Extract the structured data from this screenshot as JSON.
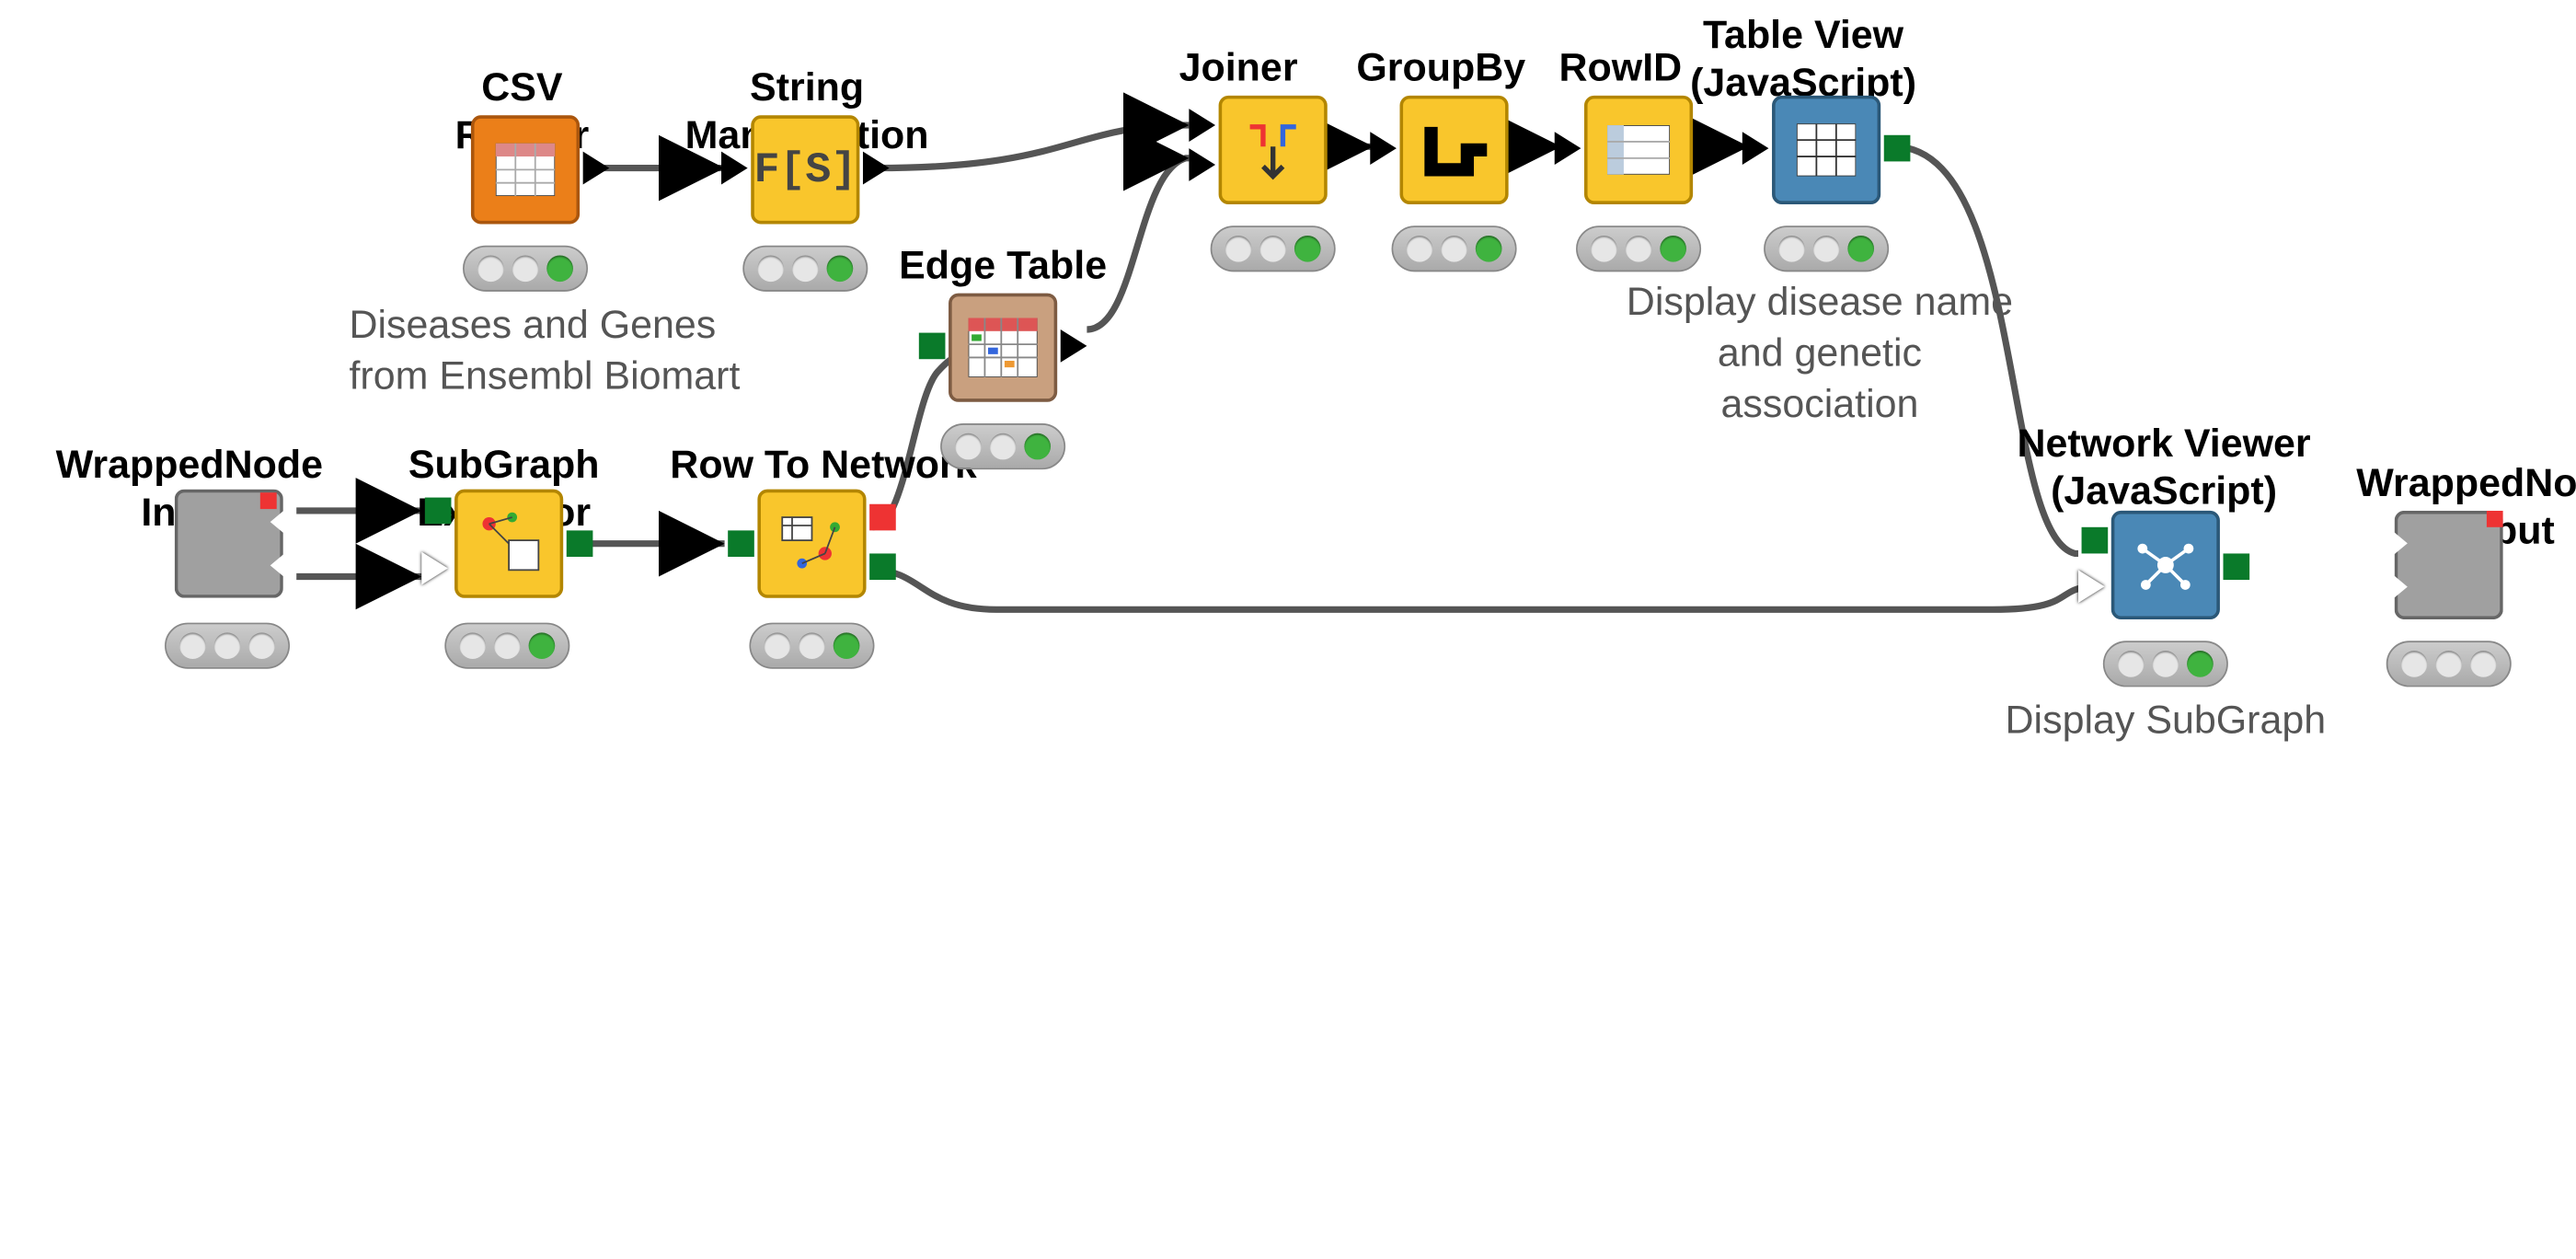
{
  "nodes": {
    "wrapped_input": {
      "title": "WrappedNode Input"
    },
    "subgraph_extractor": {
      "title": "SubGraph Extractor"
    },
    "row_to_network": {
      "title": "Row To Network"
    },
    "csv_reader": {
      "title": "CSV Reader",
      "desc": "Diseases and Genes\nfrom Ensembl Biomart"
    },
    "string_manipulation": {
      "title": "String Manipulation"
    },
    "edge_table": {
      "title": "Edge Table"
    },
    "joiner": {
      "title": "Joiner"
    },
    "groupby": {
      "title": "GroupBy"
    },
    "rowid": {
      "title": "RowID"
    },
    "table_view": {
      "title": "Table View\n(JavaScript)",
      "desc": "Display disease name\nand genetic association"
    },
    "network_viewer": {
      "title": "Network Viewer\n(JavaScript)",
      "desc": "Display SubGraph"
    },
    "wrapped_output": {
      "title": "WrappedNode Output"
    }
  },
  "wires": [
    {
      "from": "wrapped_input",
      "to": "subgraph_extractor",
      "port": "top"
    },
    {
      "from": "wrapped_input",
      "to": "subgraph_extractor",
      "port": "bottom"
    },
    {
      "from": "subgraph_extractor",
      "to": "row_to_network"
    },
    {
      "from": "row_to_network",
      "to": "edge_table"
    },
    {
      "from": "row_to_network",
      "to": "network_viewer"
    },
    {
      "from": "edge_table",
      "to": "joiner"
    },
    {
      "from": "csv_reader",
      "to": "string_manipulation"
    },
    {
      "from": "string_manipulation",
      "to": "joiner"
    },
    {
      "from": "joiner",
      "to": "groupby"
    },
    {
      "from": "groupby",
      "to": "rowid"
    },
    {
      "from": "rowid",
      "to": "table_view"
    },
    {
      "from": "table_view",
      "to": "network_viewer"
    }
  ]
}
